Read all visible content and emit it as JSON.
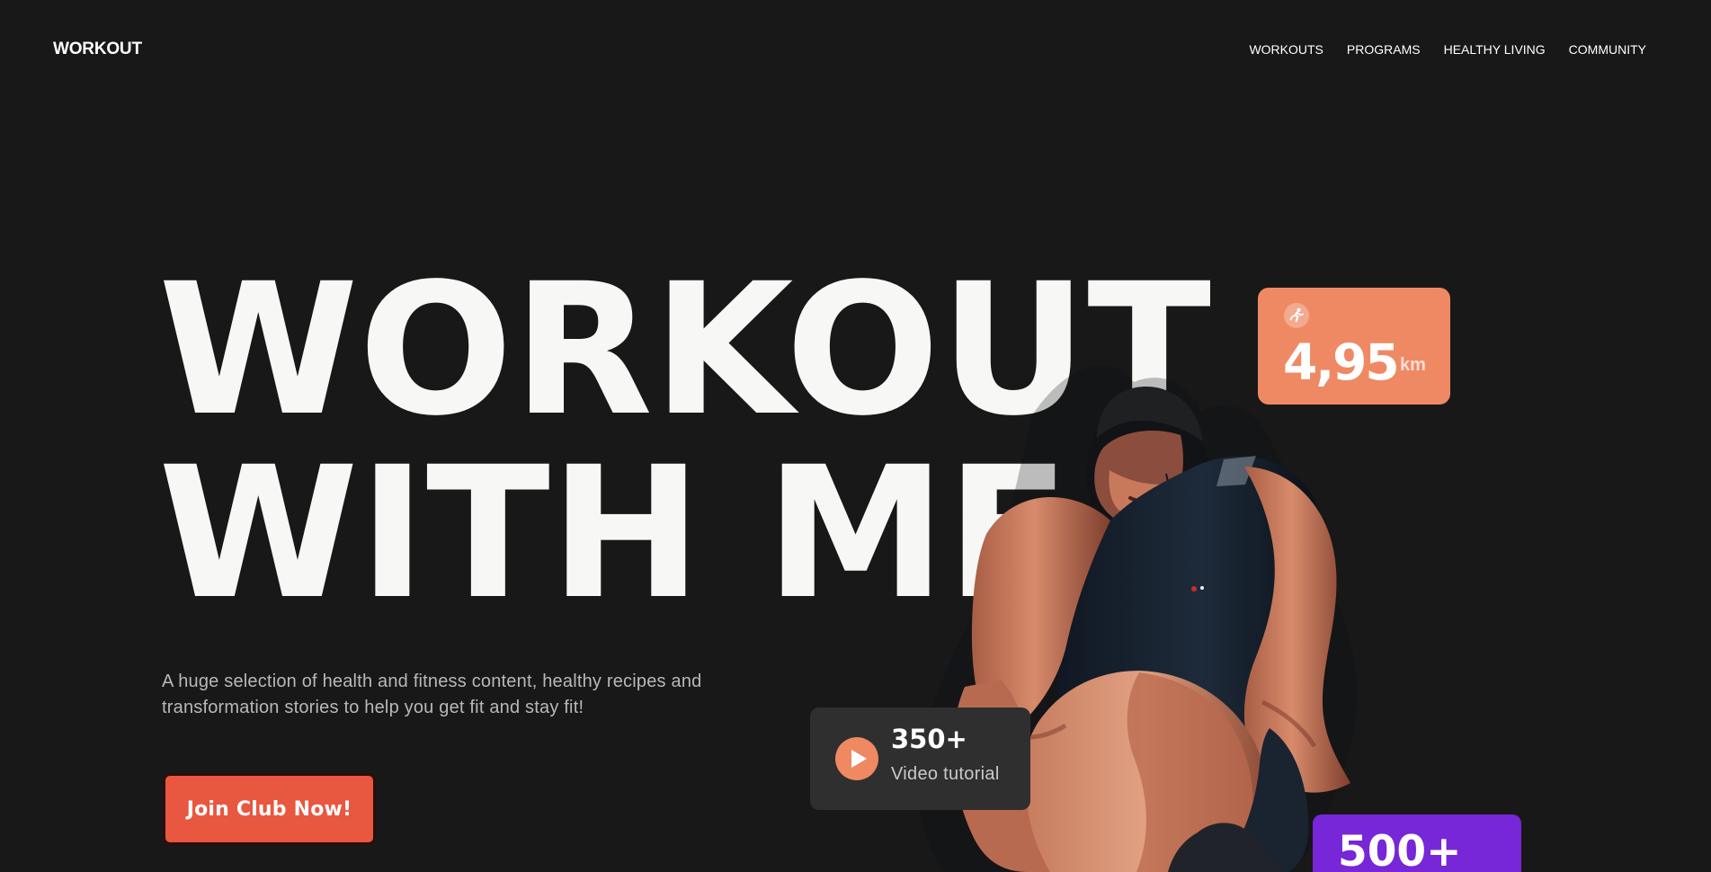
{
  "site": {
    "brand": "WORKOUT"
  },
  "nav": {
    "items": [
      "WORKOUTS",
      "PROGRAMS",
      "HEALTHY LIVING",
      "COMMUNITY"
    ]
  },
  "hero": {
    "title_line_1": "WORKOUT",
    "title_line_2": "WITH ME",
    "subtitle_line_1": "A huge selection of health and fitness content, healthy recipes and",
    "subtitle_line_2": "transformation stories to help you get fit and stay fit!",
    "cta_label": "Join Club Now!"
  },
  "stats": {
    "distance": {
      "value": "4,95",
      "unit": "km",
      "icon": "running-person-icon"
    },
    "videos": {
      "count": "350+",
      "label": "Video tutorial",
      "icon": "play-icon"
    },
    "members": {
      "count": "500+"
    }
  },
  "colors": {
    "background": "#181818",
    "text": "#f7f7f5",
    "primary_button": "#e8573f",
    "distance_card": "#ef8964",
    "video_card": "#2f2f2f",
    "members_card": "#7726d8"
  },
  "image": {
    "subject": "athlete-tying-shoe-image"
  }
}
